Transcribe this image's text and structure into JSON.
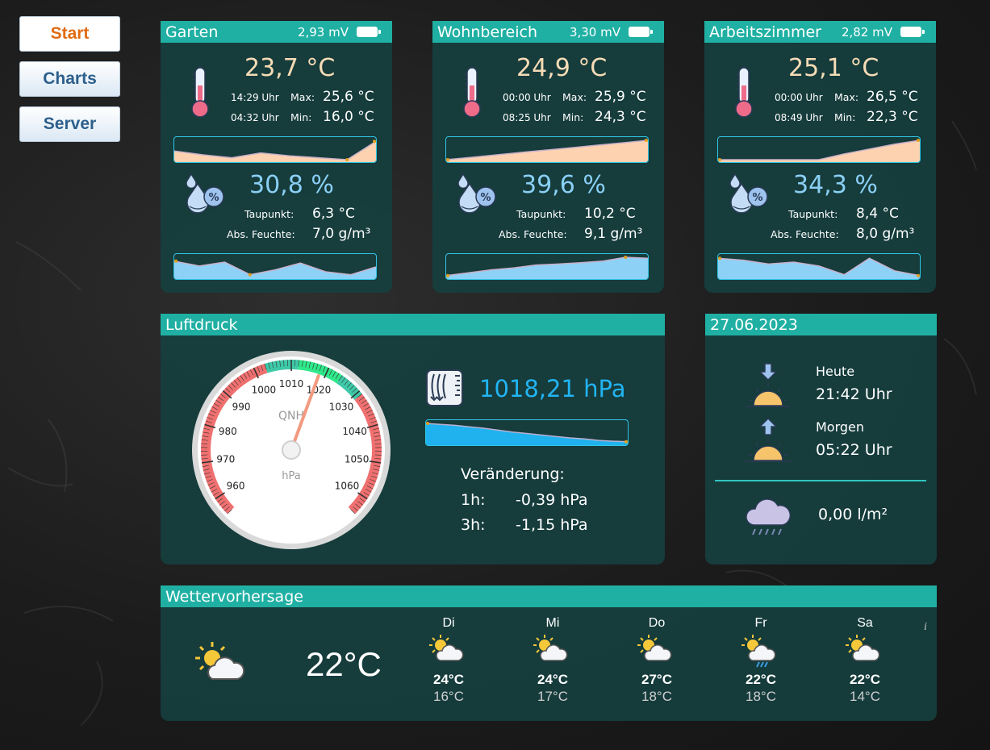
{
  "nav": [
    {
      "label": "Start",
      "active": true
    },
    {
      "label": "Charts",
      "active": false
    },
    {
      "label": "Server",
      "active": false
    }
  ],
  "rooms": [
    {
      "name": "Garten",
      "voltage": "2,93 mV",
      "temp": "23,7 °C",
      "max_time": "14:29 Uhr",
      "max_label": "Max:",
      "max_val": "25,6 °C",
      "min_time": "04:32 Uhr",
      "min_label": "Min:",
      "min_val": "16,0 °C",
      "humidity": "30,8 %",
      "dew_label": "Taupunkt:",
      "dew_val": "6,3 °C",
      "abs_label": "Abs. Feuchte:",
      "abs_val": "7,0 g/m³",
      "temp_trend": [
        0.45,
        0.25,
        0.1,
        0.35,
        0.2,
        0.1,
        0.0,
        0.95
      ],
      "hum_trend": [
        0.8,
        0.55,
        0.75,
        0.1,
        0.35,
        0.7,
        0.25,
        0.1,
        0.5
      ]
    },
    {
      "name": "Wohnbereich",
      "voltage": "3,30 mV",
      "temp": "24,9 °C",
      "max_time": "00:00 Uhr",
      "max_label": "Max:",
      "max_val": "25,9 °C",
      "min_time": "08:25 Uhr",
      "min_label": "Min:",
      "min_val": "24,3 °C",
      "humidity": "39,6 %",
      "dew_label": "Taupunkt:",
      "dew_val": "10,2 °C",
      "abs_label": "Abs. Feuchte:",
      "abs_val": "9,1 g/m³",
      "temp_trend": [
        0.0,
        0.12,
        0.25,
        0.38,
        0.5,
        0.62,
        0.75,
        0.87,
        1.0
      ],
      "hum_trend": [
        0.05,
        0.2,
        0.35,
        0.45,
        0.6,
        0.65,
        0.72,
        0.8,
        1.0,
        0.95
      ]
    },
    {
      "name": "Arbeitszimmer",
      "voltage": "2,82 mV",
      "temp": "25,1 °C",
      "max_time": "00:00 Uhr",
      "max_label": "Max:",
      "max_val": "26,5 °C",
      "min_time": "08:49 Uhr",
      "min_label": "Min:",
      "min_val": "22,3 °C",
      "humidity": "34,3 %",
      "dew_label": "Taupunkt:",
      "dew_val": "8,4 °C",
      "abs_label": "Abs. Feuchte:",
      "abs_val": "8,0 g/m³",
      "temp_trend": [
        0.0,
        0.0,
        0.0,
        0.0,
        0.0,
        0.3,
        0.55,
        0.8,
        1.0
      ],
      "hum_trend": [
        0.95,
        0.85,
        0.65,
        0.75,
        0.55,
        0.1,
        0.95,
        0.3,
        0.05
      ]
    }
  ],
  "pressure": {
    "title": "Luftdruck",
    "value": "1018,21 hPa",
    "gauge_value": 1018.21,
    "gauge_min": 955,
    "gauge_max": 1065,
    "gauge_labels": [
      "960",
      "970",
      "980",
      "990",
      "1000",
      "1010",
      "1020",
      "1030",
      "1040",
      "1050",
      "1060"
    ],
    "gauge_center_label": "QNH",
    "gauge_unit": "hPa",
    "change_title": "Veränderung:",
    "changes": [
      {
        "label": "1h:",
        "value": "-0,39 hPa"
      },
      {
        "label": "3h:",
        "value": "-1,15 hPa"
      }
    ],
    "trend": [
      1.0,
      0.95,
      0.9,
      0.82,
      0.75,
      0.65,
      0.55,
      0.48,
      0.4,
      0.32,
      0.25,
      0.2,
      0.12,
      0.08,
      0.05
    ]
  },
  "sun": {
    "date": "27.06.2023",
    "sunset_label": "Heute",
    "sunset_time": "21:42 Uhr",
    "sunrise_label": "Morgen",
    "sunrise_time": "05:22 Uhr",
    "rain": "0,00 l/m²"
  },
  "forecast": {
    "title": "Wettervorhersage",
    "current_temp": "22°C",
    "info": "i",
    "days": [
      {
        "day": "Di",
        "high": "24°C",
        "low": "16°C",
        "icon": "partly-cloudy-icon"
      },
      {
        "day": "Mi",
        "high": "24°C",
        "low": "17°C",
        "icon": "partly-cloudy-icon"
      },
      {
        "day": "Do",
        "high": "27°C",
        "low": "18°C",
        "icon": "partly-cloudy-icon"
      },
      {
        "day": "Fr",
        "high": "22°C",
        "low": "18°C",
        "icon": "rain-shower-icon"
      },
      {
        "day": "Sa",
        "high": "22°C",
        "low": "14°C",
        "icon": "partly-cloudy-icon"
      }
    ]
  },
  "colors": {
    "accent": "#20b0a3",
    "panel": "#163e3e",
    "temp": "#f6dcb6",
    "humidity": "#8ad0f5",
    "pressure": "#22b4f2"
  }
}
